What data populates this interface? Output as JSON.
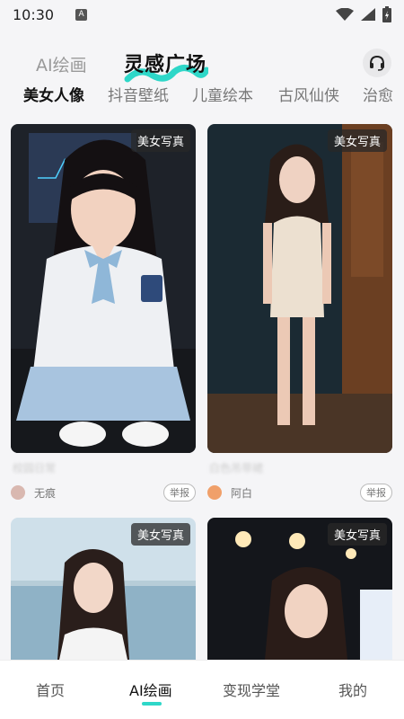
{
  "status": {
    "time": "10:30",
    "indicator": "A"
  },
  "top_tabs": {
    "ai_draw": "AI绘画",
    "inspiration": "灵感广场"
  },
  "categories": [
    "美女人像",
    "抖音壁纸",
    "儿童绘本",
    "古风仙侠",
    "治愈"
  ],
  "cards": [
    {
      "tag": "美女写真",
      "caption": "校园日常",
      "author": "无痕",
      "report": "举报"
    },
    {
      "tag": "美女写真",
      "caption": "白色吊带裙",
      "author": "阿白",
      "report": "举报"
    },
    {
      "tag": "美女写真"
    },
    {
      "tag": "美女写真"
    }
  ],
  "bottom_nav": {
    "home": "首页",
    "ai_draw": "AI绘画",
    "learn": "变现学堂",
    "mine": "我的"
  },
  "colors": {
    "accent": "#2ed7c8",
    "background": "#f5f5f7"
  }
}
